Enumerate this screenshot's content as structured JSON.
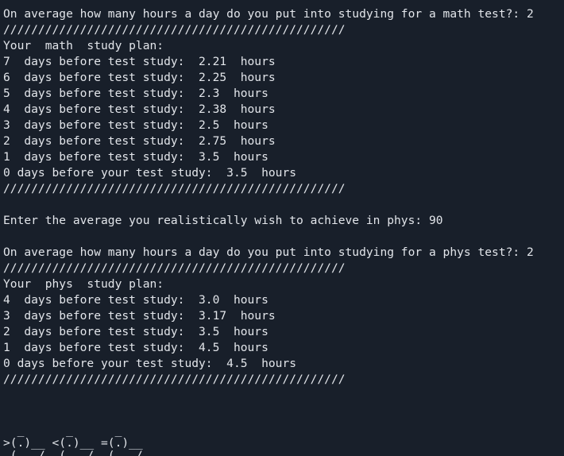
{
  "terminal": {
    "lines": [
      "On average how many hours a day do you put into studying for a math test?: 2",
      "/////////////////////////////////////////////////",
      "Your  math  study plan:",
      "7  days before test study:  2.21  hours",
      "6  days before test study:  2.25  hours",
      "5  days before test study:  2.3  hours",
      "4  days before test study:  2.38  hours",
      "3  days before test study:  2.5  hours",
      "2  days before test study:  2.75  hours",
      "1  days before test study:  3.5  hours",
      "0 days before your test study:  3.5  hours",
      "/////////////////////////////////////////////////",
      "",
      "Enter the average you realistically wish to achieve in phys: 90",
      "",
      "On average how many hours a day do you put into studying for a phys test?: 2",
      "/////////////////////////////////////////////////",
      "Your  phys  study plan:",
      "4  days before test study:  3.0  hours",
      "3  days before test study:  3.17  hours",
      "2  days before test study:  3.5  hours",
      "1  days before test study:  4.5  hours",
      "0 days before your test study:  4.5  hours",
      "/////////////////////////////////////////////////",
      "",
      ""
    ],
    "ascii_art": [
      "  _      _      _",
      ">(.)__ <(.)__ =(.)__",
      " (___/  (___/  (___/"
    ]
  }
}
